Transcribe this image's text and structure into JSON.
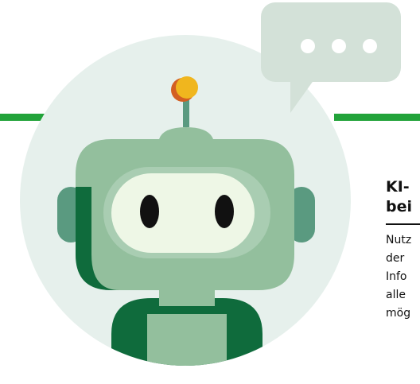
{
  "heading": {
    "line1": "KI-",
    "line2": "bei"
  },
  "body_lines": [
    "Nutz",
    "der",
    "Info",
    "alle",
    "mög"
  ],
  "colors": {
    "accent_green": "#22a33a",
    "circle_bg": "#e6f0ec",
    "robot_light": "#93bf9d",
    "robot_dark": "#0f6b3c",
    "ear": "#5a9a80",
    "face": "#eef7e6",
    "antenna_ball": "#f0b61e",
    "bubble": "#d3e1d8"
  },
  "icons": {
    "speech_bubble": "speech-bubble-icon",
    "robot": "robot-illustration"
  }
}
